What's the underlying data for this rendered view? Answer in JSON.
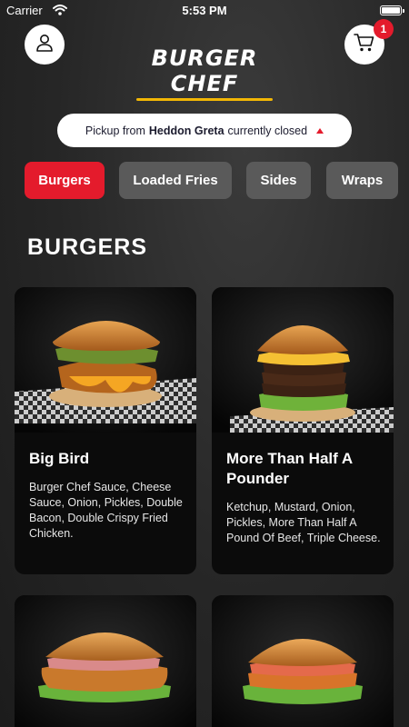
{
  "status_bar": {
    "carrier": "Carrier",
    "time": "5:53 PM",
    "battery_level": 1.0
  },
  "header": {
    "logo_text": "BURGER CHEF",
    "cart_count": "1"
  },
  "pickup": {
    "prefix": "Pickup from",
    "location": "Heddon Greta",
    "suffix": "currently closed"
  },
  "tabs": [
    {
      "label": "Burgers",
      "active": true
    },
    {
      "label": "Loaded Fries",
      "active": false
    },
    {
      "label": "Sides",
      "active": false
    },
    {
      "label": "Wraps",
      "active": false
    }
  ],
  "section_title": "BURGERS",
  "items": [
    {
      "name": "Big Bird",
      "description": "Burger Chef Sauce, Cheese Sauce, Onion, Pickles, Double Bacon, Double Crispy Fried Chicken."
    },
    {
      "name": "More Than Half A Pounder",
      "description": "Ketchup, Mustard, Onion, Pickles, More Than Half A Pound Of Beef, Triple Cheese."
    },
    {
      "name": "",
      "description": ""
    },
    {
      "name": "",
      "description": ""
    }
  ],
  "colors": {
    "accent": "#e41b2c",
    "logo_underline": "#f2b705",
    "tab_inactive": "#5a5a5a"
  }
}
